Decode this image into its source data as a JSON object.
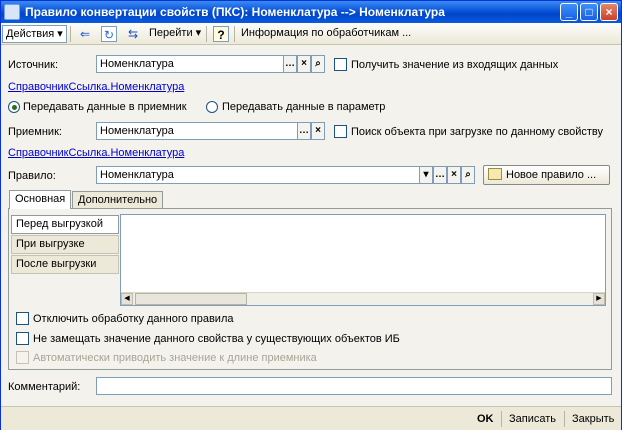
{
  "window": {
    "title": "Правило конвертации свойств (ПКС): Номенклатура --> Номенклатура"
  },
  "toolbar": {
    "actions_label": "Действия",
    "goto_label": "Перейти",
    "help_label": "?",
    "info_label": "Информация по обработчикам ..."
  },
  "form": {
    "source_label": "Источник:",
    "source_value": "Номенклатура",
    "get_from_incoming_label": "Получить значение из входящих данных",
    "source_type_link": "СправочникСсылка.Номенклатура",
    "radio_receiver_label": "Передавать данные в приемник",
    "radio_param_label": "Передавать данные в параметр",
    "receiver_label": "Приемник:",
    "receiver_value": "Номенклатура",
    "search_on_load_label": "Поиск объекта при загрузке по данному свойству",
    "receiver_type_link": "СправочникСсылка.Номенклатура",
    "rule_label": "Правило:",
    "rule_value": "Номенклатура",
    "new_rule_label": "Новое правило ..."
  },
  "tabs": [
    {
      "label": "Основная",
      "active": true
    },
    {
      "label": "Дополнительно",
      "active": false
    }
  ],
  "handlers": [
    {
      "label": "Перед выгрузкой",
      "active": true
    },
    {
      "label": "При выгрузке",
      "active": false
    },
    {
      "label": "После выгрузки",
      "active": false
    }
  ],
  "options": {
    "disable_rule_label": "Отключить обработку данного правила",
    "no_replace_label": "Не замещать значение данного свойства у существующих объектов ИБ",
    "auto_length_label": "Автоматически приводить значение к длине приемника"
  },
  "comment": {
    "label": "Комментарий:",
    "value": ""
  },
  "footer": {
    "ok_label": "OK",
    "save_label": "Записать",
    "close_label": "Закрыть"
  },
  "icons": {
    "title": "form-icon",
    "back": "arrow-left-icon",
    "refresh": "refresh-icon",
    "goto": "goto-icon"
  }
}
